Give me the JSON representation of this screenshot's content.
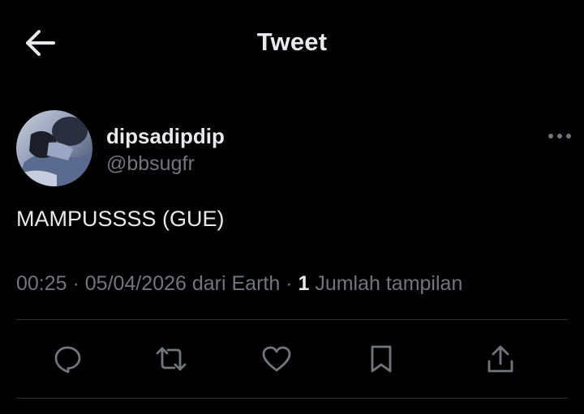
{
  "header": {
    "title": "Tweet",
    "back_icon": "arrow-left-icon"
  },
  "author": {
    "display_name": "dipsadipdip",
    "handle": "@bbsugfr",
    "more_icon": "more-horizontal-icon"
  },
  "tweet": {
    "text": "MAMPUSSSS (GUE)"
  },
  "meta": {
    "time": "00:25",
    "separator": " · ",
    "date": "05/04/2026",
    "source": " dari Earth",
    "views_count": "1",
    "views_label": " Jumlah tampilan"
  },
  "actions": [
    {
      "name": "reply-icon"
    },
    {
      "name": "retweet-icon"
    },
    {
      "name": "like-icon"
    },
    {
      "name": "bookmark-icon"
    },
    {
      "name": "share-icon"
    }
  ],
  "colors": {
    "background": "#000000",
    "text_primary": "#e7e9ea",
    "text_secondary": "#71767b",
    "divider": "#2f3336"
  }
}
